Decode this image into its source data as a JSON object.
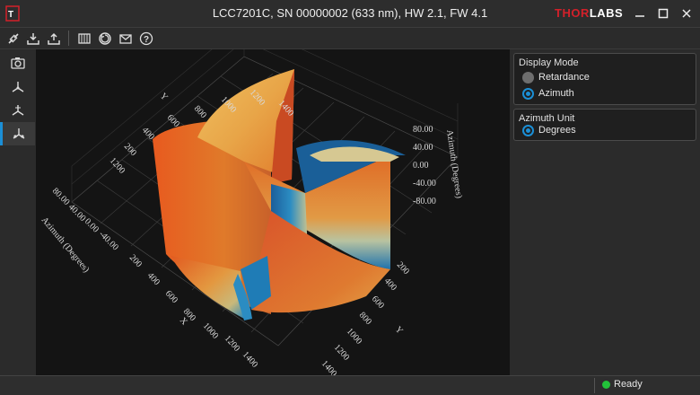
{
  "window": {
    "title": "LCC7201C, SN 00000002 (633 nm), HW 2.1, FW 4.1",
    "brand_red": "THOR",
    "brand_white": "LABS",
    "accent": "#1b8fd6"
  },
  "toolbar": {
    "icons": [
      "connect-icon",
      "download-icon",
      "upload-icon",
      "calibration-icon",
      "refresh-icon",
      "email-icon",
      "help-icon"
    ],
    "help_glyph": "?"
  },
  "sidebar": {
    "items": [
      "camera-icon",
      "axes-icon",
      "axes-alt-icon",
      "3d-plot-icon"
    ],
    "active_index": 3
  },
  "plot": {
    "x_ticks": [
      "200",
      "400",
      "600",
      "800",
      "1000",
      "1200",
      "1400"
    ],
    "x_axis_name": "X",
    "y_ticks_right": [
      "200",
      "400",
      "600",
      "800",
      "1000",
      "1200",
      "1400"
    ],
    "y_axis_name": "Y",
    "z_ticks_right": [
      "80.00",
      "40.00",
      "0.00",
      "-40.00",
      "-80.00"
    ],
    "z_axis_label_right": "Azimuth (Degrees)",
    "z_ticks_left": [
      "80.00",
      "40.00",
      "0.00",
      "-40.00"
    ],
    "z_axis_label_left": "Azimuth (Degrees)",
    "back_ticks": [
      "1200",
      "1000",
      "800",
      "600",
      "400",
      "200",
      "1400"
    ],
    "back_axis_name": "Y",
    "back_left_tick": "1200"
  },
  "display_mode": {
    "title": "Display Mode",
    "options": [
      {
        "label": "Retardance",
        "selected": false
      },
      {
        "label": "Azimuth",
        "selected": true
      }
    ]
  },
  "azimuth_unit": {
    "title": "Azimuth Unit",
    "options": [
      {
        "label": "Degrees",
        "selected": true
      }
    ]
  },
  "status": {
    "text": "Ready",
    "led_color": "#22c33a"
  }
}
